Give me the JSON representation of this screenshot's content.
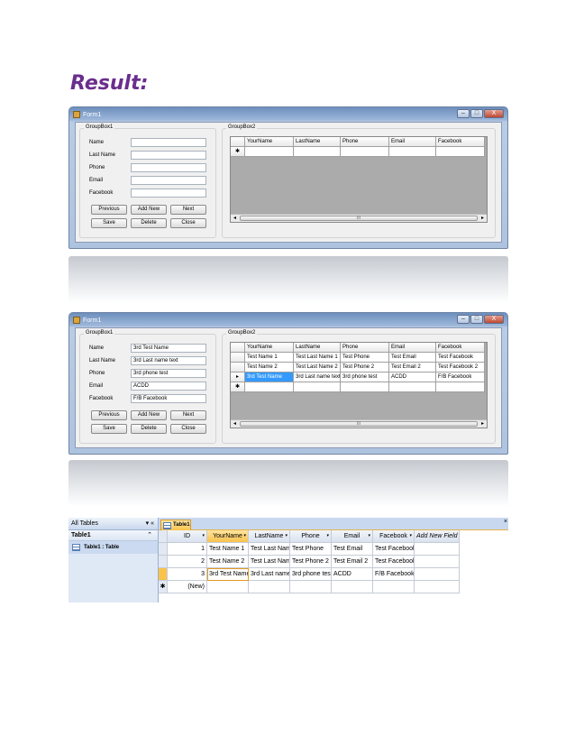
{
  "heading": "Result:",
  "form": {
    "window_title": "Form1",
    "window_buttons": {
      "minimize": "–",
      "maximize": "□",
      "close": "X"
    },
    "groupbox1_title": "GroupBox1",
    "groupbox2_title": "GroupBox2",
    "labels": [
      "Name",
      "Last Name",
      "Phone",
      "Email",
      "Facebook"
    ],
    "buttons": {
      "previous": "Previous",
      "add_new": "Add New",
      "next": "Next",
      "save": "Save",
      "delete": "Delete",
      "close": "Close"
    },
    "grid_columns": [
      "YourName",
      "LastName",
      "Phone",
      "Email",
      "Facebook"
    ],
    "scroll_thumb": "III",
    "row_marker_current": "▸",
    "row_marker_new": "✱"
  },
  "shot2": {
    "fields": [
      "3rd Test Name",
      "3rd Last name text",
      "3rd phone test",
      "ACDD",
      "F/B Facebook"
    ],
    "rows": [
      [
        "Test Name 1",
        "Test Last Name 1",
        "Test Phone",
        "Test Email",
        "Test Facebook"
      ],
      [
        "Test Name 2",
        "Test Last Name 2",
        "Test Phone 2",
        "Test Email 2",
        "Test Facebook 2"
      ],
      [
        "3rd Test Name",
        "3rd Last name text",
        "3rd phone test",
        "ACDD",
        "F/B Facebook"
      ]
    ]
  },
  "access": {
    "nav_title": "All Tables",
    "nav_controls": "▾ «",
    "group_name": "Table1",
    "group_control": "⌃",
    "item_label": "Table1 : Table",
    "tab_label": "Table1",
    "columns": [
      "ID",
      "YourName",
      "LastName",
      "Phone",
      "Email",
      "Facebook",
      "Add New Field"
    ],
    "rows": [
      [
        "1",
        "Test Name 1",
        "Test Last Name",
        "Test Phone",
        "Test Email",
        "Test Facebook"
      ],
      [
        "2",
        "Test Name 2",
        "Test Last Name",
        "Test Phone 2",
        "Test Email 2",
        "Test Facebook"
      ],
      [
        "3",
        "3rd Test Name",
        "3rd Last name",
        "3rd phone test",
        "ACDD",
        "F/B Facebook"
      ]
    ],
    "new_row_marker": "✱",
    "new_row_label": "(New)"
  }
}
